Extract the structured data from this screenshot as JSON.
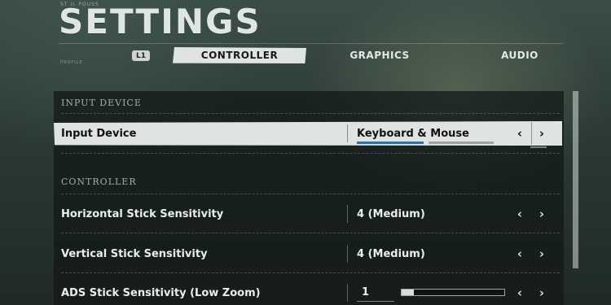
{
  "header": {
    "title": "SETTINGS",
    "ticker_top": "ST IL POUSS",
    "ticker_sub": "PROFILE"
  },
  "tabs": {
    "left_bumper": "L1",
    "items": [
      {
        "label": "CONTROLLER",
        "active": true
      },
      {
        "label": "GRAPHICS",
        "active": false
      },
      {
        "label": "AUDIO",
        "active": false
      }
    ]
  },
  "sections": {
    "input_device": {
      "header": "INPUT DEVICE",
      "rows": [
        {
          "label": "Input Device",
          "value": "Keyboard & Mouse",
          "selected": true
        }
      ]
    },
    "controller": {
      "header": "CONTROLLER",
      "rows": [
        {
          "label": "Horizontal Stick Sensitivity",
          "value": "4 (Medium)"
        },
        {
          "label": "Vertical Stick Sensitivity",
          "value": "4 (Medium)"
        },
        {
          "label": "ADS Stick Sensitivity (Low Zoom)",
          "value": "1",
          "slider_fraction": 0.12
        }
      ]
    }
  },
  "glyphs": {
    "prev": "‹",
    "next": "›"
  },
  "colors": {
    "selected_row": "#dfe4e1",
    "accent_bar": "#2a6fb0"
  }
}
